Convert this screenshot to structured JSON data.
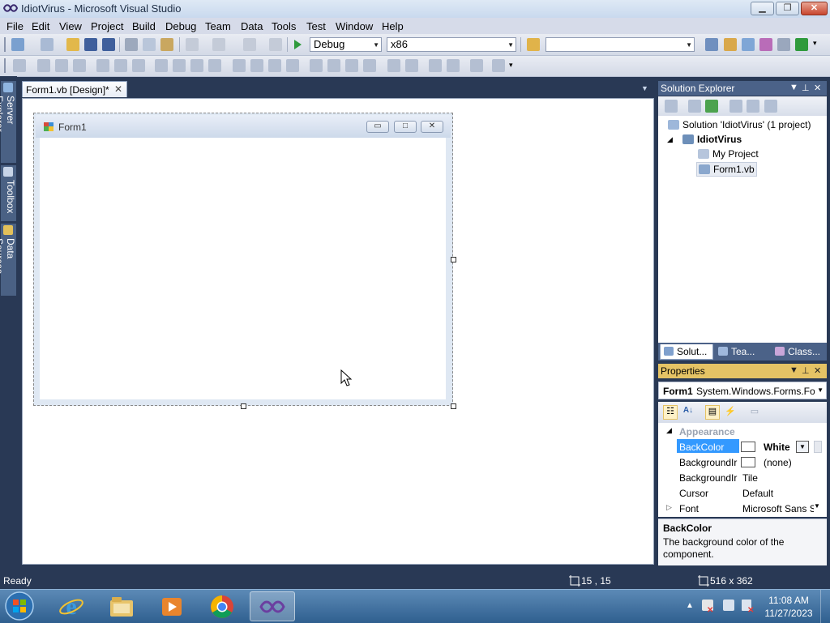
{
  "window": {
    "title": "IdiotVirus - Microsoft Visual Studio",
    "min_glyph": "▁",
    "max_glyph": "❐",
    "close_glyph": "✕"
  },
  "menu": [
    "File",
    "Edit",
    "View",
    "Project",
    "Build",
    "Debug",
    "Team",
    "Data",
    "Tools",
    "Test",
    "Window",
    "Help"
  ],
  "toolbar": {
    "config": "Debug",
    "platform": "x86",
    "find_value": ""
  },
  "side_tabs": [
    "Server Explorer",
    "Toolbox",
    "Data Sources"
  ],
  "document": {
    "tab_label": "Form1.vb [Design]*",
    "tab_close": "✕"
  },
  "design_form": {
    "title": "Form1",
    "min_glyph": "▭",
    "max_glyph": "□",
    "close_glyph": "✕"
  },
  "solution_explorer": {
    "title": "Solution Explorer",
    "items": [
      {
        "label": "Solution 'IdiotVirus' (1 project)",
        "icon": "solution-icon"
      },
      {
        "label": "IdiotVirus",
        "icon": "vb-project-icon"
      },
      {
        "label": "My Project",
        "icon": "my-project-icon"
      },
      {
        "label": "Form1.vb",
        "icon": "form-file-icon"
      }
    ],
    "tabs": [
      "Solut...",
      "Tea...",
      "Class..."
    ]
  },
  "properties": {
    "title": "Properties",
    "object_name": "Form1",
    "object_type": "System.Windows.Forms.Fo",
    "category": "Appearance",
    "rows": [
      {
        "name": "BackColor",
        "value": "White",
        "swatch": "#ffffff"
      },
      {
        "name": "BackgroundIr",
        "value": "(none)",
        "swatch": "#ffffff"
      },
      {
        "name": "BackgroundIr",
        "value": "Tile"
      },
      {
        "name": "Cursor",
        "value": "Default"
      },
      {
        "name": "Font",
        "value": "Microsoft Sans S"
      }
    ],
    "description_title": "BackColor",
    "description_text": "The background color of the component."
  },
  "status": {
    "text": "Ready",
    "position": "15 , 15",
    "size": "516 x 362"
  },
  "taskbar": {
    "time": "11:08 AM",
    "date": "11/27/2023"
  },
  "colors": {
    "chrome": "#293955",
    "properties_header": "#e5c365",
    "selection": "#3399ff"
  }
}
